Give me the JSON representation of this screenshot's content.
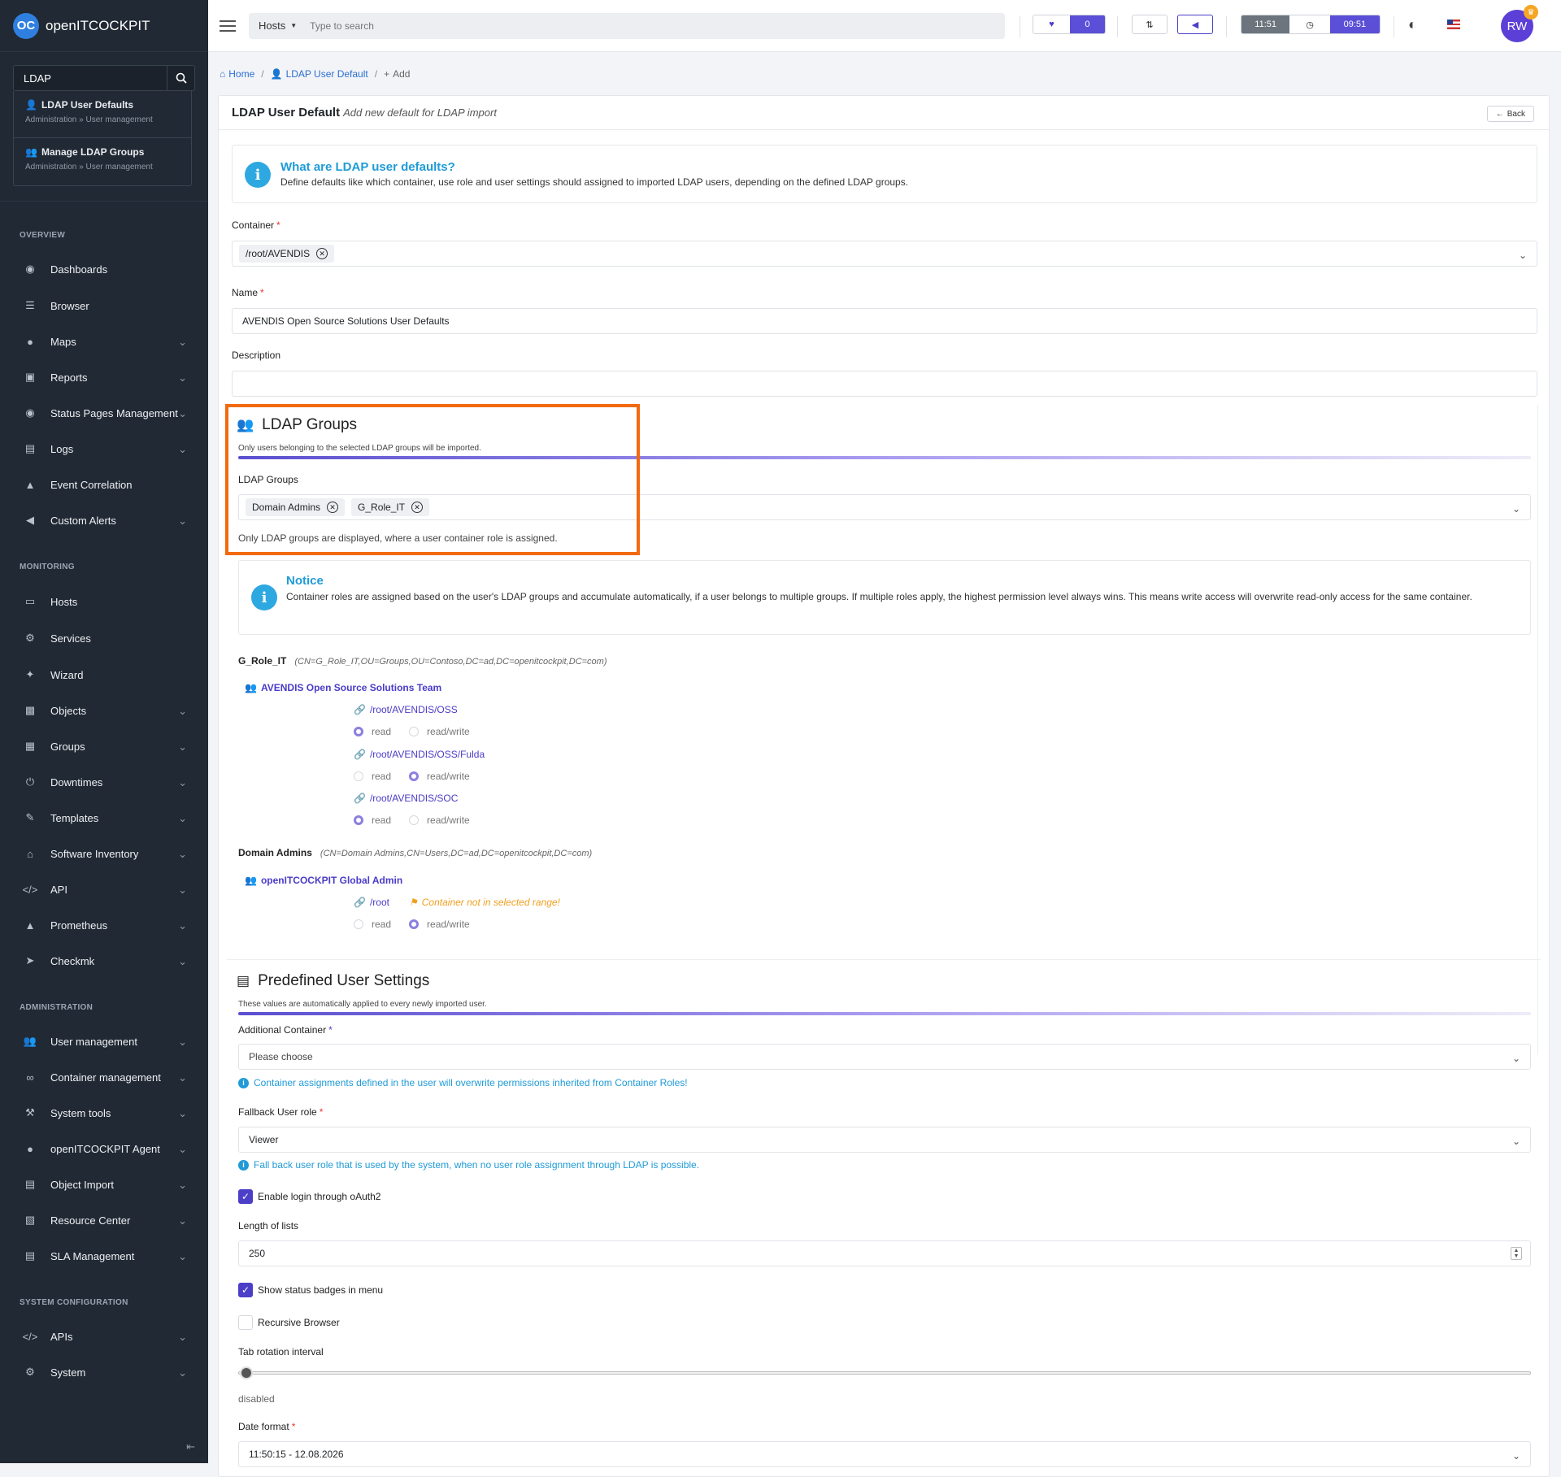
{
  "app": {
    "brand": "openITCOCKPIT",
    "logo": "OC"
  },
  "sidebar": {
    "search_value": "LDAP",
    "results": [
      {
        "title": "LDAP User Defaults",
        "subtitle": "Administration » User management"
      },
      {
        "title": "Manage LDAP Groups",
        "subtitle": "Administration » User management"
      }
    ],
    "sections": {
      "overview": "OVERVIEW",
      "monitoring": "MONITORING",
      "administration": "ADMINISTRATION",
      "system_configuration": "SYSTEM CONFIGURATION"
    },
    "items": {
      "dashboards": "Dashboards",
      "browser": "Browser",
      "maps": "Maps",
      "reports": "Reports",
      "status_pages": "Status Pages Management",
      "logs": "Logs",
      "event_correlation": "Event Correlation",
      "custom_alerts": "Custom Alerts",
      "hosts": "Hosts",
      "services": "Services",
      "wizard": "Wizard",
      "objects": "Objects",
      "groups": "Groups",
      "downtimes": "Downtimes",
      "templates": "Templates",
      "software_inventory": "Software Inventory",
      "api": "API",
      "prometheus": "Prometheus",
      "checkmk": "Checkmk",
      "user_management": "User management",
      "container_management": "Container management",
      "system_tools": "System tools",
      "agent": "openITCOCKPIT Agent",
      "object_import": "Object Import",
      "resource_center": "Resource Center",
      "sla_management": "SLA Management",
      "apis": "APIs",
      "system": "System"
    }
  },
  "topbar": {
    "search_scope": "Hosts",
    "search_placeholder": "Type to search",
    "notification_count": "0",
    "time_local": "11:51",
    "time_server": "09:51",
    "avatar_initials": "RW"
  },
  "breadcrumb": {
    "home": "Home",
    "parent": "LDAP User Default",
    "current": "Add"
  },
  "card": {
    "title": "LDAP User Default",
    "subtitle": "Add new default for LDAP import",
    "back_label": "Back"
  },
  "info": {
    "title": "What are LDAP user defaults?",
    "text": "Define defaults like which container, use role and user settings should assigned to imported LDAP users, depending on the defined LDAP groups."
  },
  "form": {
    "container_label": "Container",
    "container_value": "/root/AVENDIS",
    "name_label": "Name",
    "name_value": "AVENDIS Open Source Solutions User Defaults",
    "description_label": "Description",
    "description_value": ""
  },
  "ldap_groups": {
    "section_title": "LDAP Groups",
    "section_sub": "Only users belonging to the selected LDAP groups will be imported.",
    "field_label": "LDAP Groups",
    "chips": [
      "Domain Admins",
      "G_Role_IT"
    ],
    "help": "Only LDAP groups are displayed, where a user container role is assigned.",
    "highlight_color": "#f26a10"
  },
  "notice": {
    "title": "Notice",
    "text": "Container roles are assigned based on the user's LDAP groups and accumulate automatically, if a user belongs to multiple groups. If multiple roles apply, the highest permission level always wins. This means write access will overwrite read-only access for the same container."
  },
  "groups": [
    {
      "name": "G_Role_IT",
      "dn": "(CN=G_Role_IT,OU=Groups,OU=Contoso,DC=ad,DC=openitcockpit,DC=com)",
      "team": "AVENDIS Open Source Solutions Team",
      "paths": [
        {
          "path": "/root/AVENDIS/OSS",
          "read": "read",
          "readwrite": "read/write",
          "selected": "read"
        },
        {
          "path": "/root/AVENDIS/OSS/Fulda",
          "read": "read",
          "readwrite": "read/write",
          "selected": "read/write"
        },
        {
          "path": "/root/AVENDIS/SOC",
          "read": "read",
          "readwrite": "read/write",
          "selected": "read"
        }
      ]
    },
    {
      "name": "Domain Admins",
      "dn": "(CN=Domain Admins,CN=Users,DC=ad,DC=openitcockpit,DC=com)",
      "team": "openITCOCKPIT Global Admin",
      "paths": [
        {
          "path": "/root",
          "warning": "Container not in selected range!",
          "read": "read",
          "readwrite": "read/write",
          "selected": "read/write"
        }
      ]
    }
  ],
  "user_settings": {
    "section_title": "Predefined User Settings",
    "section_sub": "These values are automatically applied to every newly imported user.",
    "additional_container_label": "Additional Container",
    "additional_container_value": "Please choose",
    "additional_container_hint": "Container assignments defined in the user will overwrite permissions inherited from Container Roles!",
    "fallback_role_label": "Fallback User role",
    "fallback_role_value": "Viewer",
    "fallback_role_hint": "Fall back user role that is used by the system, when no user role assignment through LDAP is possible.",
    "oauth_label": "Enable login through oAuth2",
    "oauth_checked": true,
    "length_label": "Length of lists",
    "length_value": "250",
    "badges_label": "Show status badges in menu",
    "badges_checked": true,
    "recursive_label": "Recursive Browser",
    "recursive_checked": false,
    "tab_rotation_label": "Tab rotation interval",
    "tab_rotation_level": 0,
    "tab_rotation_value": "disabled",
    "date_format_label": "Date format",
    "date_format_value": "11:50:15 - 12.08.2026"
  },
  "colors": {
    "accent": "#4b3fc8",
    "info": "#1f9bd7",
    "sidebar_bg": "#212934",
    "highlight": "#f26a10"
  }
}
